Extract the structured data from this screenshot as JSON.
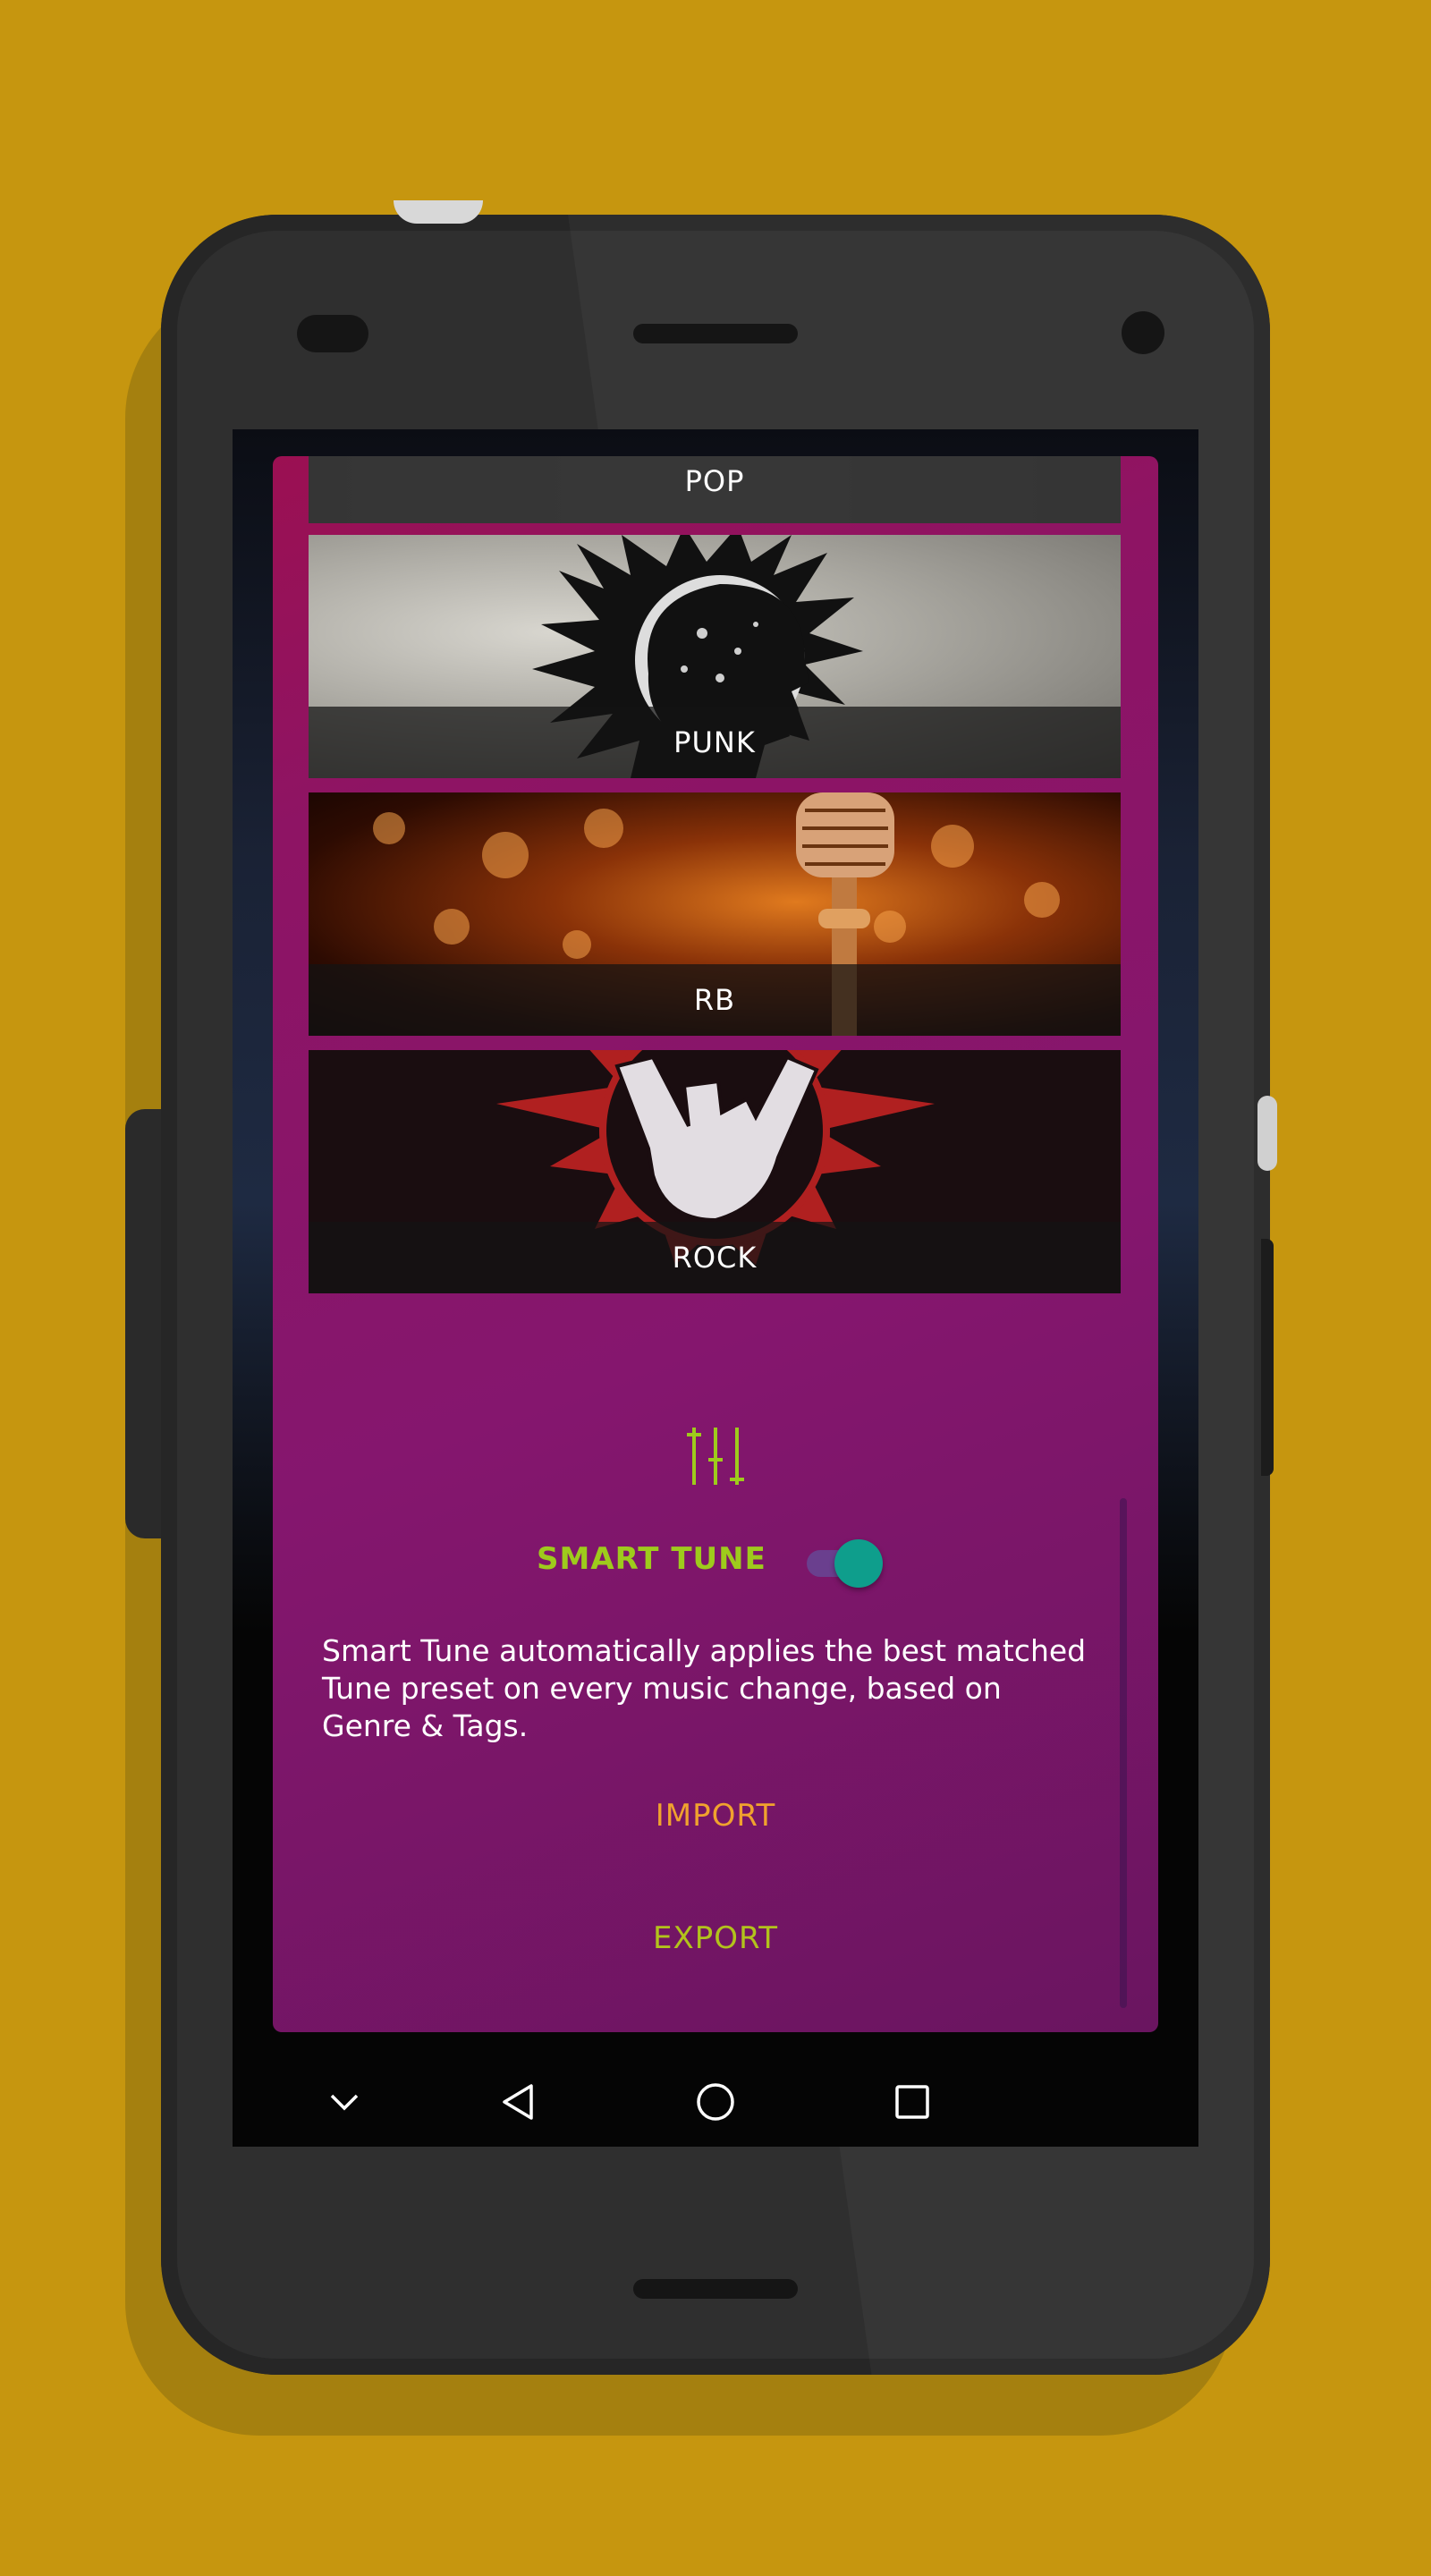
{
  "genres": [
    {
      "label": "POP"
    },
    {
      "label": "PUNK"
    },
    {
      "label": "RB"
    },
    {
      "label": "ROCK"
    }
  ],
  "smart_tune": {
    "label": "SMART TUNE",
    "enabled": true,
    "description": "Smart Tune automatically applies the best matched Tune preset on every music change, based on Genre & Tags."
  },
  "actions": {
    "import_label": "IMPORT",
    "export_label": "EXPORT"
  },
  "colors": {
    "background": "#C6960F",
    "card_accent": "#8E1464",
    "smart_tune_label": "#9ECB1C",
    "toggle_on": "#0E9E8C",
    "import": "#F0A22E",
    "export": "#B2C21C"
  },
  "icons": {
    "equalizer": "equalizer-icon",
    "nav_hide": "chevron-down-icon",
    "nav_back": "back-triangle-icon",
    "nav_home": "home-circle-icon",
    "nav_recents": "recents-square-icon"
  }
}
